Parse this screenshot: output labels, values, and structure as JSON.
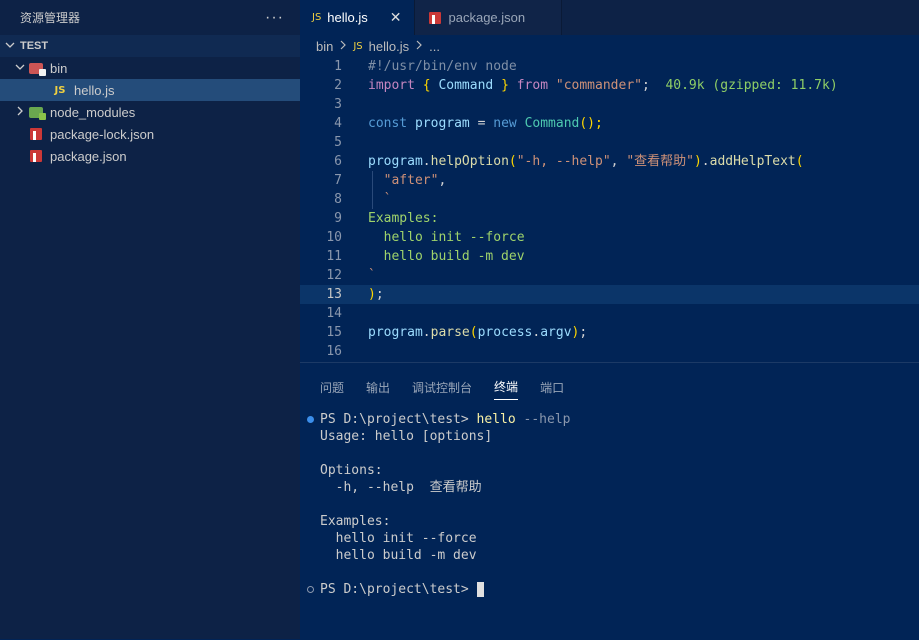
{
  "explorer": {
    "title": "资源管理器",
    "more": "···",
    "section": "TEST",
    "items": [
      {
        "label": "bin",
        "kind": "folder-bin"
      },
      {
        "label": "hello.js",
        "kind": "js"
      },
      {
        "label": "node_modules",
        "kind": "folder-node"
      },
      {
        "label": "package-lock.json",
        "kind": "npm"
      },
      {
        "label": "package.json",
        "kind": "npm"
      }
    ]
  },
  "tabs": [
    {
      "icon": "JS",
      "label": "hello.js",
      "close": "✕"
    },
    {
      "label": "package.json"
    }
  ],
  "breadcrumb": {
    "folder": "bin",
    "icon": "JS",
    "file": "hello.js",
    "more": "..."
  },
  "editor": {
    "line_numbers": [
      "1",
      "2",
      "3",
      "4",
      "5",
      "6",
      "7",
      "8",
      "9",
      "10",
      "11",
      "12",
      "13",
      "14",
      "15",
      "16"
    ],
    "l1": "#!/usr/bin/env node",
    "l2_import": "import",
    "l2_ob": "{",
    "l2_cmd": "Command",
    "l2_cb": "}",
    "l2_from": "from",
    "l2_str": "\"commander\"",
    "l2_semi": ";",
    "l2_hint": "40.9k (gzipped: 11.7k)",
    "l4_const": "const",
    "l4_prog": "program",
    "l4_eq": "=",
    "l4_new": "new",
    "l4_cls": "Command",
    "l4_paren": "();",
    "l6_prog": "program",
    "l6_dot": ".",
    "l6_fn": "helpOption",
    "l6_op": "(",
    "l6_s1": "\"-h, --help\"",
    "l6_comma": ", ",
    "l6_s2": "\"查看帮助\"",
    "l6_cp": ")",
    "l6_dot2": ".",
    "l6_fn2": "addHelpText",
    "l6_op2": "(",
    "l7": "\"after\"",
    "l7_comma": ",",
    "l8": "`",
    "l9": "Examples:",
    "l10": "hello init --force",
    "l11": "hello build -m dev",
    "l12": "`",
    "l13_p": ")",
    "l13_s": ";",
    "l15_prog": "program",
    "l15_fn": "parse",
    "l15_op": "(",
    "l15_proc": "process",
    "l15_argv": "argv",
    "l15_cp": ")",
    "l15_semi": ";"
  },
  "panel": {
    "tabs": [
      "问题",
      "输出",
      "调试控制台",
      "终端",
      "端口"
    ],
    "active_tab": "终端"
  },
  "terminal": {
    "prompt1": "PS D:\\project\\test> ",
    "cmd": "hello",
    "arg": " --help",
    "usage": "Usage: hello [options]",
    "options_header": "Options:",
    "option_flag": "  -h, --help  ",
    "option_desc": "查看帮助",
    "examples_header": "Examples:",
    "ex1": "  hello init --force",
    "ex2": "  hello build -m dev",
    "prompt2": "PS D:\\project\\test> "
  }
}
